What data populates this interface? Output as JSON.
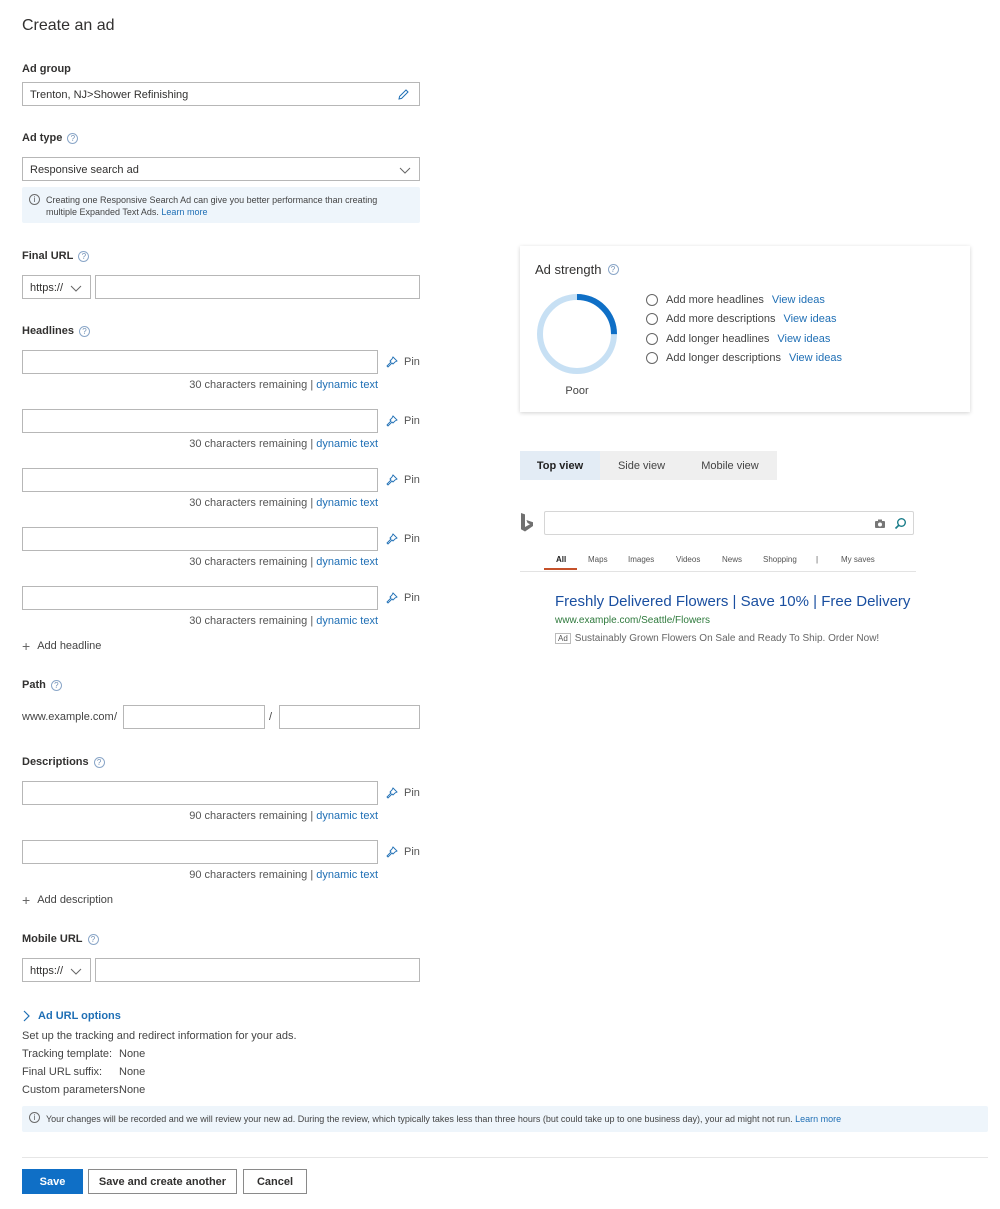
{
  "page": {
    "title": "Create an ad"
  },
  "ad_group": {
    "label": "Ad group",
    "value": "Trenton, NJ>Shower Refinishing"
  },
  "ad_type": {
    "label": "Ad type",
    "value": "Responsive search ad",
    "info_line1": "Creating one Responsive Search Ad can give you better performance than creating",
    "info_line2": "multiple Expanded Text Ads.",
    "info_link": "Learn more"
  },
  "final_url": {
    "label": "Final URL",
    "protocol": "https://",
    "value": ""
  },
  "headlines": {
    "label": "Headlines",
    "items": [
      {
        "value": "",
        "remaining": "30 characters remaining |",
        "dynamic": "dynamic text",
        "pin": "Pin"
      },
      {
        "value": "",
        "remaining": "30 characters remaining |",
        "dynamic": "dynamic text",
        "pin": "Pin"
      },
      {
        "value": "",
        "remaining": "30 characters remaining |",
        "dynamic": "dynamic text",
        "pin": "Pin"
      },
      {
        "value": "",
        "remaining": "30 characters remaining |",
        "dynamic": "dynamic text",
        "pin": "Pin"
      },
      {
        "value": "",
        "remaining": "30 characters remaining |",
        "dynamic": "dynamic text",
        "pin": "Pin"
      }
    ],
    "add_label": "Add headline"
  },
  "path": {
    "label": "Path",
    "domain": "www.example.com",
    "separator1": "/",
    "separator2": "/",
    "path1": "",
    "path2": ""
  },
  "descriptions": {
    "label": "Descriptions",
    "items": [
      {
        "value": "",
        "remaining": "90 characters remaining |",
        "dynamic": "dynamic text",
        "pin": "Pin"
      },
      {
        "value": "",
        "remaining": "90 characters remaining |",
        "dynamic": "dynamic text",
        "pin": "Pin"
      }
    ],
    "add_label": "Add description"
  },
  "mobile_url": {
    "label": "Mobile URL",
    "protocol": "https://",
    "value": ""
  },
  "url_options": {
    "toggle_label": "Ad URL options",
    "description": "Set up the tracking and redirect information for your ads.",
    "rows": [
      {
        "key": "Tracking template:",
        "value": "None"
      },
      {
        "key": "Final URL suffix:",
        "value": "None"
      },
      {
        "key": "Custom parameters:",
        "value": "None"
      }
    ]
  },
  "review_notice": {
    "text": "Your changes will be recorded and we will review your new ad. During the review, which typically takes less than three hours (but could take up to one business day), your ad might not run.",
    "link": "Learn more"
  },
  "buttons": {
    "save": "Save",
    "save_another": "Save and create another",
    "cancel": "Cancel"
  },
  "ad_strength": {
    "label": "Ad strength",
    "rating": "Poor",
    "progress_fraction": 0.25,
    "accent_color": "#0f6fc6",
    "track_color": "#c7e0f4",
    "suggestions": [
      {
        "text": "Add more headlines",
        "link": "View ideas"
      },
      {
        "text": "Add more descriptions",
        "link": "View ideas"
      },
      {
        "text": "Add longer headlines",
        "link": "View ideas"
      },
      {
        "text": "Add longer descriptions",
        "link": "View ideas"
      }
    ]
  },
  "preview": {
    "tabs": [
      "Top view",
      "Side view",
      "Mobile view"
    ],
    "active_tab": "Top view",
    "serp_tabs": [
      "All",
      "Maps",
      "Images",
      "Videos",
      "News",
      "Shopping",
      "|",
      "My saves"
    ],
    "ad_title": "Freshly Delivered Flowers | Save 10% | Free Delivery",
    "ad_url": "www.example.com/Seattle/Flowers",
    "ad_badge": "Ad",
    "ad_description": "Sustainably Grown Flowers On Sale and Ready To Ship. Order Now!"
  }
}
